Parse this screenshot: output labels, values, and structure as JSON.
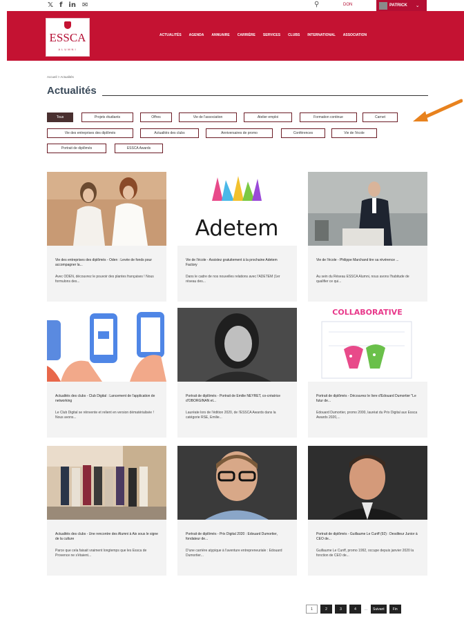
{
  "topbar": {
    "social_icons": [
      "twitter-icon",
      "facebook-icon",
      "linkedin-icon",
      "email-icon"
    ],
    "social_glyphs": [
      "𝕏",
      "f",
      "in",
      "✉"
    ],
    "search_glyph": "⚲",
    "don_label": "DON",
    "user_name": "PATRICK"
  },
  "brand": {
    "name": "ESSCA",
    "sub": "ALUMNI",
    "color": "#c41232"
  },
  "nav": [
    "ACTUALITÉS",
    "AGENDA",
    "ANNUAIRE",
    "CARRIÈRE",
    "SERVICES",
    "CLUBS",
    "INTERNATIONAL",
    "ASSOCIATION"
  ],
  "breadcrumb": "Accueil  >  Actualités",
  "page_title": "Actualités",
  "filters": {
    "row1": [
      "Tous",
      "Projets étudiants",
      "Offres",
      "Vie de l'association",
      "Atelier emploi",
      "Formation continue",
      "Carnet"
    ],
    "row2": [
      "Vie des entreprises des diplômés",
      "Actualités des clubs",
      "Anniversaires de promo",
      "Conférences",
      "Vie de l'école"
    ],
    "row3": [
      "Portrait de diplômés",
      "ESSCA Awards"
    ],
    "active": "Tous"
  },
  "cards": [
    {
      "title": "Vie des entreprises des diplômés - Oden : Levée de fonds pour accompagner la...",
      "desc": "Avec ODEN, découvrez le pouvoir des plantes françaises ! Nous formulons des..."
    },
    {
      "title": "Vie de l'école - Assistez gratuitement à la prochaine Adetem Factory",
      "desc": "Dans le cadre de nos nouvelles relations avec l'ADETEM (1er réseau des...",
      "image_text": "Adetem"
    },
    {
      "title": "Vie de l'école - Philippe Marchand tire sa révérence ...",
      "desc": "Au sein du Réseau ESSCA Alumni, nous avons l'habitude de qualifier ce qui..."
    },
    {
      "title": "Actualités des clubs - Club Digital : Lancement de l'application de networking",
      "desc": "Le Club Digital se réinvente et relient en version dématérialisée ! Nous avons..."
    },
    {
      "title": "Portrait de diplômés - Portrait de Emilie NEYRET, co-créatrice d'OBORGINAN et...",
      "desc": "Lauréate lors de l'édition 2020, de l'ESSCA Awards dans la catégorie RSE, Emilie..."
    },
    {
      "title": "Portrait de diplômés - Découvrez le livre d'Edouard Dumortier \"Le futur de...",
      "desc": "Edouard Dumortier, promo 2000, lauréat du Prix Digital aux Essca Awards 2020,...",
      "image_text": "COLLABORATIVE"
    },
    {
      "title": "Actualités des clubs - Une rencontre des Alumni à Aix sous le signe de la culture",
      "desc": "Parce que cela faisait vraiment longtemps que les Essca de Provence ne s'étaient..."
    },
    {
      "title": "Portrait de diplômés - Prix Digital 2020 : Edouard Dumortier, fondateur de...",
      "desc": "D'une carrière atypique à l'aventure entrepreneuriale : Edouard Dumortier..."
    },
    {
      "title": "Portrait de diplômés - Guillaume Le Cunff (92) : Desditeur Junior à CEO de...",
      "desc": "Guillaume Le Cunff, promo 1992, occupe depuis janvier 2020 la fonction de CEO de..."
    }
  ],
  "pagination": {
    "pages": [
      "1",
      "2",
      "3",
      "4"
    ],
    "ellipsis": "...",
    "next": "Suivant",
    "last": "Fin",
    "current": "1"
  },
  "colors": {
    "accent": "#c41232",
    "arrow": "#e8821e"
  }
}
